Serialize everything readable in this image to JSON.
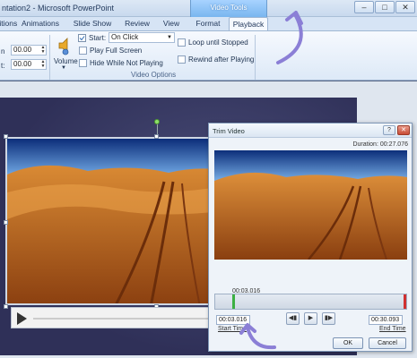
{
  "window": {
    "title": "ntation2 - Microsoft PowerPoint",
    "contextual_group": "Video Tools",
    "controls": [
      "–",
      "□",
      "✕"
    ]
  },
  "tabs": {
    "items": [
      "Transitions",
      "Animations",
      "Slide Show",
      "Review",
      "View",
      "Format",
      "Playback"
    ],
    "active": "Playback"
  },
  "ribbon": {
    "editing": {
      "fade_in_value": "00.00",
      "fade_out_value": "00.00",
      "fade_in_label_fragment": "n",
      "fade_out_label_fragment": "t:"
    },
    "video_options": {
      "volume_label": "Volume",
      "start_label": "Start:",
      "start_value": "On Click",
      "play_full_screen": "Play Full Screen",
      "hide_while_not_playing": "Hide While Not Playing",
      "loop_until_stopped": "Loop until Stopped",
      "rewind_after_playing": "Rewind after Playing",
      "group_label": "Video Options"
    }
  },
  "trim_dialog": {
    "title": "Trim Video",
    "duration_label": "Duration:",
    "duration_value": "00:27.076",
    "playhead_time": "00:03.016",
    "start_time_value": "00:03.016",
    "end_time_value": "00:30.093",
    "start_time_label": "Start Time",
    "end_time_label": "End Time",
    "ok_label": "OK",
    "cancel_label": "Cancel",
    "help_glyph": "?",
    "close_glyph": "✕"
  },
  "colors": {
    "accent_arrow": "#8b7fd6",
    "trim_start_marker": "#3cb043",
    "trim_end_marker": "#d03030"
  }
}
